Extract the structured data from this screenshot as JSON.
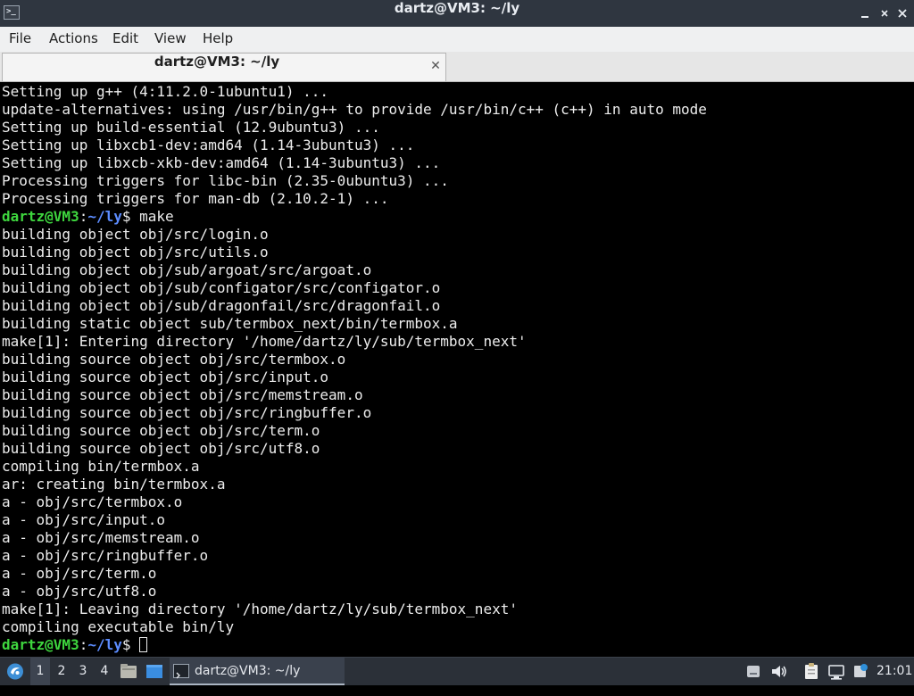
{
  "window": {
    "title": "dartz@VM3: ~/ly",
    "icon": "terminal-icon",
    "controls": [
      "minimize-icon",
      "maximize-icon",
      "close-icon"
    ]
  },
  "menubar": {
    "items": [
      "File",
      "Actions",
      "Edit",
      "View",
      "Help"
    ]
  },
  "tabs": [
    {
      "label": "dartz@VM3: ~/ly",
      "close": "✕"
    }
  ],
  "terminal": {
    "prompt_user": "dartz@VM3",
    "prompt_path": "~/ly",
    "lines": [
      {
        "text": "Setting up g++ (4:11.2.0-1ubuntu1) ..."
      },
      {
        "text": "update-alternatives: using /usr/bin/g++ to provide /usr/bin/c++ (c++) in auto mode"
      },
      {
        "text": "Setting up build-essential (12.9ubuntu3) ..."
      },
      {
        "text": "Setting up libxcb1-dev:amd64 (1.14-3ubuntu3) ..."
      },
      {
        "text": "Setting up libxcb-xkb-dev:amd64 (1.14-3ubuntu3) ..."
      },
      {
        "text": "Processing triggers for libc-bin (2.35-0ubuntu3) ..."
      },
      {
        "text": "Processing triggers for man-db (2.10.2-1) ..."
      },
      {
        "prompt": true,
        "cmd": " make"
      },
      {
        "text": "building object obj/src/login.o"
      },
      {
        "text": "building object obj/src/utils.o"
      },
      {
        "text": "building object obj/sub/argoat/src/argoat.o"
      },
      {
        "text": "building object obj/sub/configator/src/configator.o"
      },
      {
        "text": "building object obj/sub/dragonfail/src/dragonfail.o"
      },
      {
        "text": "building static object sub/termbox_next/bin/termbox.a"
      },
      {
        "text": "make[1]: Entering directory '/home/dartz/ly/sub/termbox_next'"
      },
      {
        "text": "building source object obj/src/termbox.o"
      },
      {
        "text": "building source object obj/src/input.o"
      },
      {
        "text": "building source object obj/src/memstream.o"
      },
      {
        "text": "building source object obj/src/ringbuffer.o"
      },
      {
        "text": "building source object obj/src/term.o"
      },
      {
        "text": "building source object obj/src/utf8.o"
      },
      {
        "text": "compiling bin/termbox.a"
      },
      {
        "text": "ar: creating bin/termbox.a"
      },
      {
        "text": "a - obj/src/termbox.o"
      },
      {
        "text": "a - obj/src/input.o"
      },
      {
        "text": "a - obj/src/memstream.o"
      },
      {
        "text": "a - obj/src/ringbuffer.o"
      },
      {
        "text": "a - obj/src/term.o"
      },
      {
        "text": "a - obj/src/utf8.o"
      },
      {
        "text": "make[1]: Leaving directory '/home/dartz/ly/sub/termbox_next'"
      },
      {
        "text": "compiling executable bin/ly"
      },
      {
        "prompt": true,
        "cmd": " ",
        "cursor": true
      }
    ]
  },
  "taskbar": {
    "start_icon": "lxqt-start-icon",
    "workspaces": [
      "1",
      "2",
      "3",
      "4"
    ],
    "active_workspace": "1",
    "quicklaunch": [
      "file-manager-icon",
      "show-desktop-icon"
    ],
    "task": {
      "icon": "terminal-icon",
      "label": "dartz@VM3: ~/ly"
    },
    "tray": [
      "drive-icon",
      "volume-icon",
      "clipboard-icon",
      "network-icon",
      "update-icon"
    ],
    "clock": "21:01"
  },
  "colors": {
    "terminal_bg": "#000000",
    "terminal_fg": "#ededed",
    "prompt_user": "#3ed63e",
    "prompt_path": "#5c8cff",
    "titlebar": "#2f3640",
    "taskbar": "#2b3038"
  }
}
